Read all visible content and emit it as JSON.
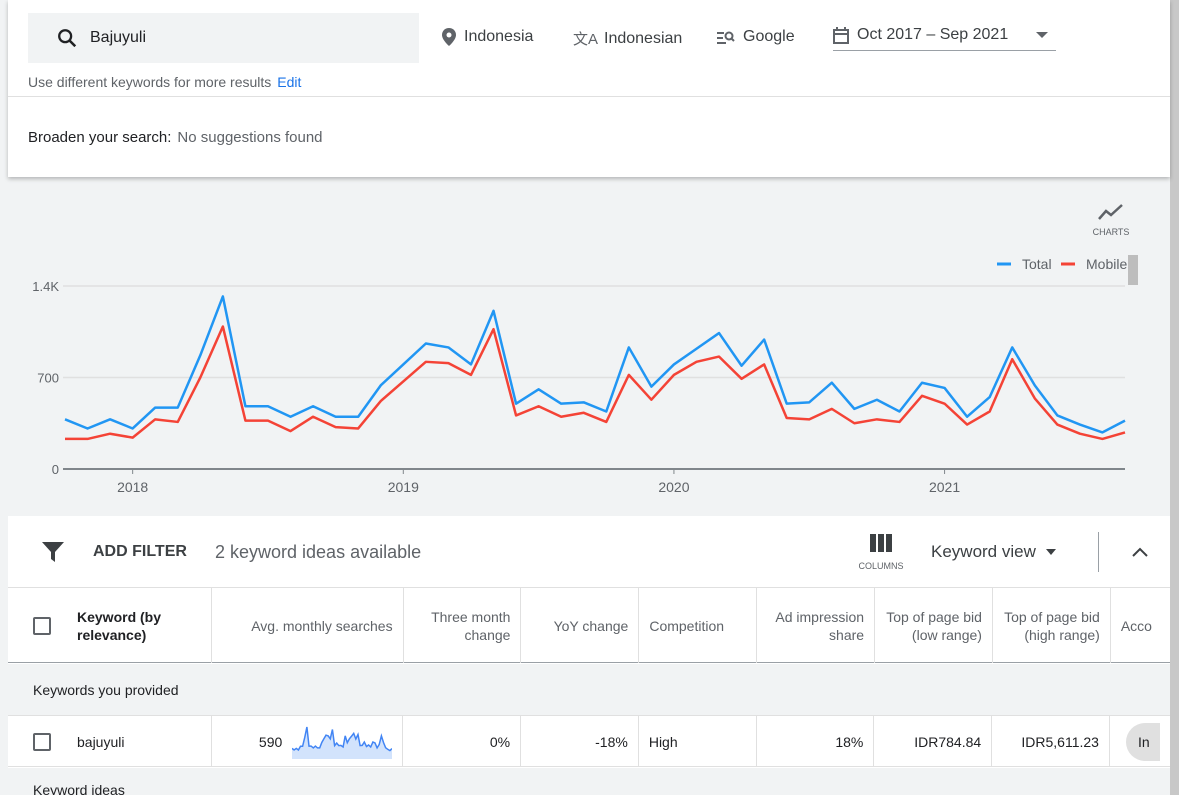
{
  "search": {
    "query": "Bajuyuli",
    "location": "Indonesia",
    "language": "Indonesian",
    "network": "Google",
    "date_range": "Oct 2017 – Sep 2021",
    "hint": "Use different keywords for more results",
    "edit_label": "Edit"
  },
  "broaden": {
    "label": "Broaden your search:",
    "value": "No suggestions found"
  },
  "chart_toggle": {
    "label": "CHARTS"
  },
  "chart_data": {
    "type": "line",
    "x_start": "Oct 2017",
    "x_end": "Sep 2021",
    "x_ticks": [
      "2018",
      "2019",
      "2020",
      "2021"
    ],
    "y_ticks": [
      "0",
      "700",
      "1.4K"
    ],
    "ylim": [
      0,
      1400
    ],
    "grid": true,
    "legend": "top-right",
    "series": [
      {
        "name": "Total",
        "color": "#2196f3",
        "values": [
          380,
          310,
          380,
          310,
          470,
          470,
          870,
          1320,
          480,
          480,
          400,
          480,
          400,
          400,
          640,
          800,
          960,
          930,
          800,
          1210,
          500,
          610,
          500,
          510,
          440,
          930,
          630,
          800,
          920,
          1040,
          790,
          990,
          500,
          510,
          660,
          460,
          530,
          440,
          660,
          620,
          400,
          550,
          930,
          640,
          410,
          340,
          280,
          370
        ]
      },
      {
        "name": "Mobile",
        "color": "#f44336",
        "values": [
          230,
          230,
          270,
          240,
          380,
          360,
          700,
          1090,
          370,
          370,
          290,
          400,
          320,
          310,
          520,
          670,
          820,
          810,
          720,
          1070,
          410,
          480,
          400,
          430,
          360,
          720,
          530,
          720,
          820,
          860,
          690,
          800,
          390,
          380,
          460,
          350,
          380,
          360,
          560,
          500,
          340,
          440,
          840,
          540,
          340,
          270,
          230,
          280
        ]
      }
    ]
  },
  "filter": {
    "add_label": "ADD FILTER",
    "count_text": "2 keyword ideas available",
    "columns_label": "COLUMNS",
    "view_label": "Keyword view"
  },
  "table": {
    "headers": [
      "Keyword (by relevance)",
      "Avg. monthly searches",
      "Three month change",
      "YoY change",
      "Competition",
      "Ad impression share",
      "Top of page bid (low range)",
      "Top of page bid (high range)",
      "Acco"
    ],
    "section1": "Keywords you provided",
    "section2": "Keyword ideas",
    "rows": [
      {
        "keyword": "bajuyuli",
        "avg": "590",
        "three_month": "0%",
        "yoy": "-18%",
        "competition": "High",
        "ad_share": "18%",
        "bid_low": "IDR784.84",
        "bid_high": "IDR5,611.23",
        "account": "In"
      }
    ]
  }
}
